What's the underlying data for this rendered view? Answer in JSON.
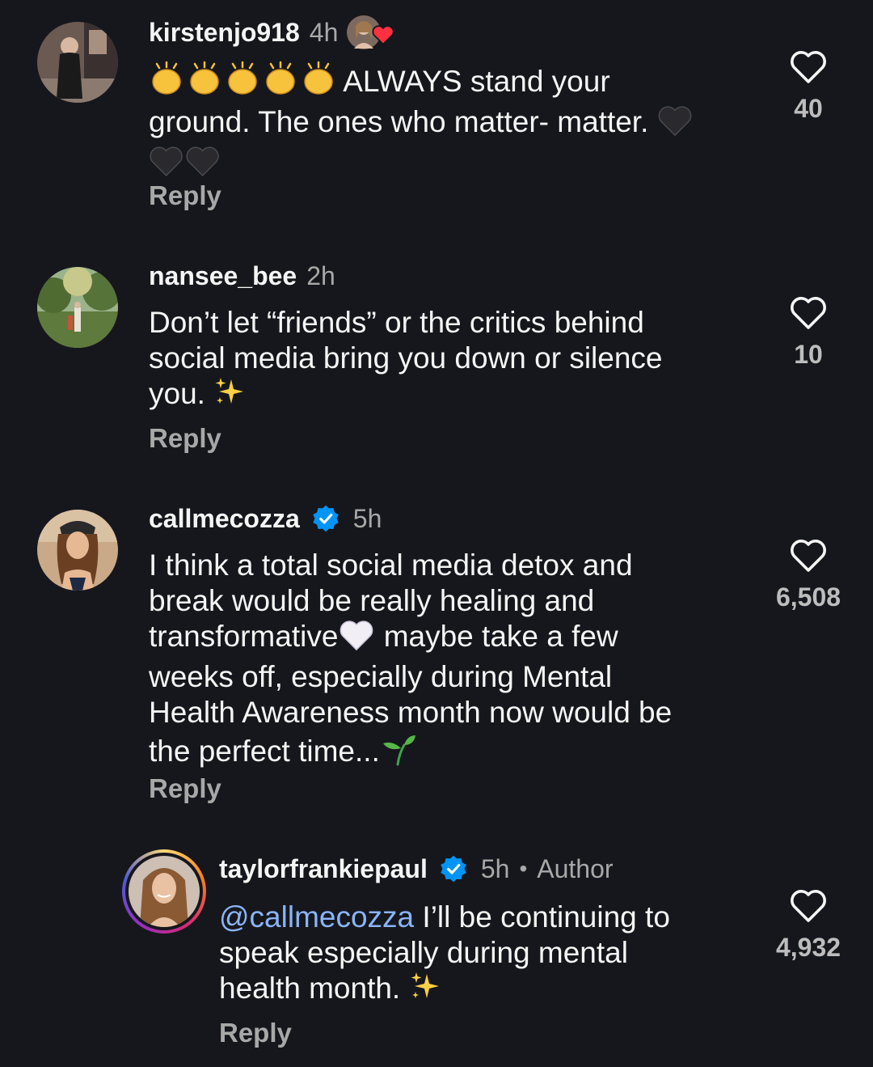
{
  "comments": [
    {
      "username": "kirstenjo918",
      "time": "4h",
      "text_line1": "ALWAYS stand your",
      "text_line2": "ground. The ones who matter- matter.",
      "reply_label": "Reply",
      "likes": "40",
      "liked_by_author": true,
      "emojis": [
        "clapping-hands",
        "black-heart"
      ]
    },
    {
      "username": "nansee_bee",
      "time": "2h",
      "text_line1": "Don’t let “friends” or the critics behind",
      "text_line2": "social media bring you down or silence",
      "text_line3": "you.",
      "reply_label": "Reply",
      "likes": "10",
      "emojis": [
        "sparkles"
      ]
    },
    {
      "username": "callmecozza",
      "verified": true,
      "time": "5h",
      "text_line1": "I think a total social media detox and",
      "text_line2": "break would be really healing and",
      "text_line3a": "transformative",
      "text_line3b": " maybe take a few",
      "text_line4": "weeks off, especially during Mental",
      "text_line5": "Health Awareness month now would be",
      "text_line6": "the perfect time...",
      "reply_label": "Reply",
      "likes": "6,508",
      "emojis": [
        "white-heart",
        "seedling"
      ]
    },
    {
      "username": "taylorfrankiepaul",
      "verified": true,
      "time": "5h",
      "separator": "•",
      "author_label": "Author",
      "mention": "@callmecozza",
      "text_line1": " I’ll be continuing to",
      "text_line2": "speak especially during mental",
      "text_line3": "health month.",
      "reply_label": "Reply",
      "likes": "4,932",
      "emojis": [
        "sparkles"
      ]
    }
  ],
  "colors": {
    "background": "#16171c",
    "text": "#f5f5f5",
    "muted": "#a8a8a8",
    "verified": "#0095f6",
    "mention": "#8ab4f8",
    "author_heart": "#ff3040"
  }
}
